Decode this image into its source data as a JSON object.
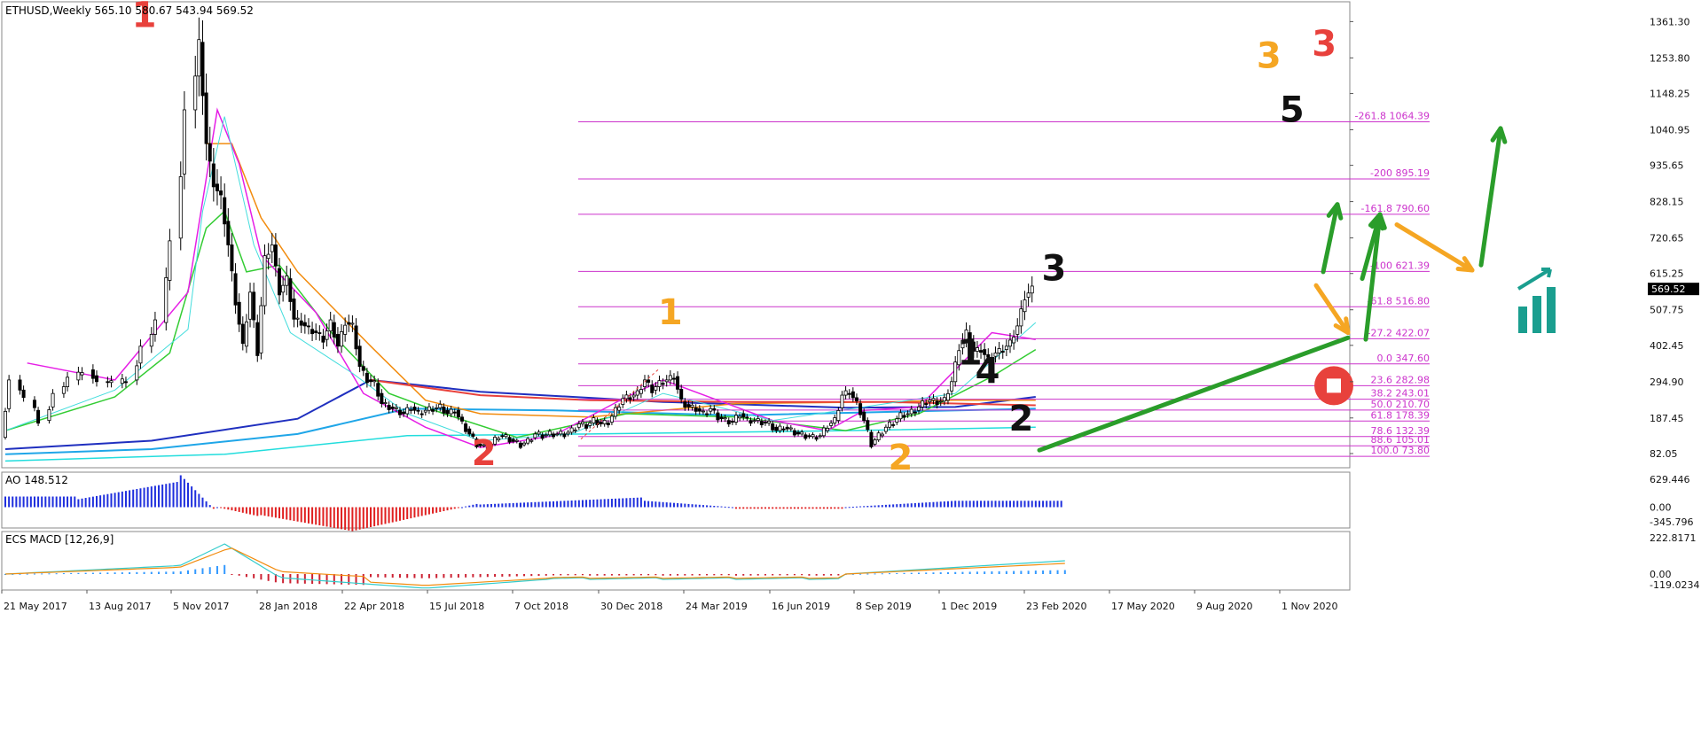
{
  "chart_data": {
    "type": "candlestick",
    "header": "ETHUSD,Weekly  565.10 580.67 543.94 569.52",
    "current_price_label": "569.52",
    "price_scale": {
      "min": 40,
      "max": 1420,
      "log": false
    },
    "price_ticks": [
      "1361.30",
      "1253.80",
      "1148.25",
      "1040.95",
      "935.65",
      "828.15",
      "720.65",
      "615.25",
      "507.75",
      "402.45",
      "294.90",
      "187.45",
      "82.05"
    ],
    "date_ticks": [
      "21 May 2017",
      "13 Aug 2017",
      "5 Nov 2017",
      "28 Jan 2018",
      "22 Apr 2018",
      "15 Jul 2018",
      "7 Oct 2018",
      "30 Dec 2018",
      "24 Mar 2019",
      "16 Jun 2019",
      "8 Sep 2019",
      "1 Dec 2019",
      "23 Feb 2020",
      "17 May 2020",
      "9 Aug 2020",
      "1 Nov 2020"
    ],
    "fib_levels": [
      {
        "label": "-261.8 1064.39",
        "value": 1064.39
      },
      {
        "label": "-200  895.19",
        "value": 895.19
      },
      {
        "label": "-161.8 790.60",
        "value": 790.6
      },
      {
        "label": "-100  621.39",
        "value": 621.39
      },
      {
        "label": "-61.8 516.80",
        "value": 516.8
      },
      {
        "label": "-27.2 422.07",
        "value": 422.07
      },
      {
        "label": "0.0 347.60",
        "value": 347.6
      },
      {
        "label": "23.6 282.98",
        "value": 282.98
      },
      {
        "label": "38.2 243.01",
        "value": 243.01
      },
      {
        "label": "50.0 210.70",
        "value": 210.7
      },
      {
        "label": "61.8 178.39",
        "value": 178.39
      },
      {
        "label": "78.6 132.39",
        "value": 132.39
      },
      {
        "label": "88.6 105.01",
        "value": 105.01
      },
      {
        "label": "100.0 73.80",
        "value": 73.8
      }
    ],
    "wave_labels": [
      {
        "text": "1",
        "color": "#e8413c",
        "date": 38,
        "price": 1345
      },
      {
        "text": "2",
        "color": "#e8413c",
        "date": 131,
        "price": 48
      },
      {
        "text": "1",
        "color": "#f5a623",
        "date": 182,
        "price": 465
      },
      {
        "text": "2",
        "color": "#f5a623",
        "date": 245,
        "price": 35
      },
      {
        "text": "1",
        "color": "#111111",
        "date": 264,
        "price": 345
      },
      {
        "text": "2",
        "color": "#111111",
        "date": 278,
        "price": 150
      },
      {
        "text": "3",
        "color": "#111111",
        "date": 287,
        "price": 595
      },
      {
        "text": "4",
        "color": "#111111",
        "date": 303,
        "price": 290
      },
      {
        "text": "5",
        "color": "#111111",
        "date": 369,
        "price": 1065
      },
      {
        "text": "3",
        "color": "#f5a623",
        "date": 364,
        "price": 1225
      },
      {
        "text": "3",
        "color": "#e8413c",
        "date": 376,
        "price": 1260
      }
    ],
    "weekly_closes": [
      {
        "i": 0,
        "c": 130
      },
      {
        "i": 4,
        "c": 300
      },
      {
        "i": 8,
        "c": 240
      },
      {
        "i": 12,
        "c": 180
      },
      {
        "i": 16,
        "c": 260
      },
      {
        "i": 20,
        "c": 300
      },
      {
        "i": 24,
        "c": 330
      },
      {
        "i": 28,
        "c": 295
      },
      {
        "i": 32,
        "c": 290
      },
      {
        "i": 36,
        "c": 300
      },
      {
        "i": 40,
        "c": 400
      },
      {
        "i": 44,
        "c": 470
      },
      {
        "i": 48,
        "c": 720
      },
      {
        "i": 52,
        "c": 1100
      },
      {
        "i": 54,
        "c": 1300
      },
      {
        "i": 56,
        "c": 1000
      },
      {
        "i": 58,
        "c": 880
      },
      {
        "i": 60,
        "c": 840
      },
      {
        "i": 62,
        "c": 700
      },
      {
        "i": 64,
        "c": 530
      },
      {
        "i": 66,
        "c": 400
      },
      {
        "i": 68,
        "c": 560
      },
      {
        "i": 70,
        "c": 380
      },
      {
        "i": 72,
        "c": 660
      },
      {
        "i": 74,
        "c": 700
      },
      {
        "i": 76,
        "c": 560
      },
      {
        "i": 78,
        "c": 600
      },
      {
        "i": 80,
        "c": 480
      },
      {
        "i": 82,
        "c": 470
      },
      {
        "i": 84,
        "c": 450
      },
      {
        "i": 86,
        "c": 440
      },
      {
        "i": 88,
        "c": 420
      },
      {
        "i": 90,
        "c": 470
      },
      {
        "i": 92,
        "c": 400
      },
      {
        "i": 94,
        "c": 470
      },
      {
        "i": 96,
        "c": 460
      },
      {
        "i": 98,
        "c": 340
      },
      {
        "i": 100,
        "c": 300
      },
      {
        "i": 102,
        "c": 290
      },
      {
        "i": 104,
        "c": 230
      },
      {
        "i": 106,
        "c": 220
      },
      {
        "i": 108,
        "c": 210
      },
      {
        "i": 110,
        "c": 200
      },
      {
        "i": 112,
        "c": 220
      },
      {
        "i": 114,
        "c": 200
      },
      {
        "i": 116,
        "c": 210
      },
      {
        "i": 118,
        "c": 215
      },
      {
        "i": 120,
        "c": 220
      },
      {
        "i": 122,
        "c": 200
      },
      {
        "i": 124,
        "c": 210
      },
      {
        "i": 126,
        "c": 170
      },
      {
        "i": 128,
        "c": 140
      },
      {
        "i": 130,
        "c": 110
      },
      {
        "i": 132,
        "c": 100
      },
      {
        "i": 134,
        "c": 110
      },
      {
        "i": 136,
        "c": 135
      },
      {
        "i": 138,
        "c": 130
      },
      {
        "i": 140,
        "c": 118
      },
      {
        "i": 142,
        "c": 108
      },
      {
        "i": 144,
        "c": 118
      },
      {
        "i": 146,
        "c": 140
      },
      {
        "i": 148,
        "c": 135
      },
      {
        "i": 150,
        "c": 140
      },
      {
        "i": 152,
        "c": 140
      },
      {
        "i": 154,
        "c": 140
      },
      {
        "i": 156,
        "c": 150
      },
      {
        "i": 158,
        "c": 170
      },
      {
        "i": 160,
        "c": 165
      },
      {
        "i": 162,
        "c": 180
      },
      {
        "i": 164,
        "c": 170
      },
      {
        "i": 166,
        "c": 175
      },
      {
        "i": 168,
        "c": 210
      },
      {
        "i": 170,
        "c": 245
      },
      {
        "i": 172,
        "c": 250
      },
      {
        "i": 174,
        "c": 260
      },
      {
        "i": 176,
        "c": 300
      },
      {
        "i": 178,
        "c": 270
      },
      {
        "i": 180,
        "c": 290
      },
      {
        "i": 182,
        "c": 300
      },
      {
        "i": 184,
        "c": 310
      },
      {
        "i": 186,
        "c": 235
      },
      {
        "i": 188,
        "c": 220
      },
      {
        "i": 190,
        "c": 215
      },
      {
        "i": 192,
        "c": 200
      },
      {
        "i": 194,
        "c": 215
      },
      {
        "i": 196,
        "c": 190
      },
      {
        "i": 198,
        "c": 180
      },
      {
        "i": 200,
        "c": 175
      },
      {
        "i": 202,
        "c": 200
      },
      {
        "i": 204,
        "c": 180
      },
      {
        "i": 206,
        "c": 180
      },
      {
        "i": 208,
        "c": 175
      },
      {
        "i": 210,
        "c": 170
      },
      {
        "i": 212,
        "c": 150
      },
      {
        "i": 214,
        "c": 160
      },
      {
        "i": 216,
        "c": 150
      },
      {
        "i": 218,
        "c": 140
      },
      {
        "i": 220,
        "c": 135
      },
      {
        "i": 222,
        "c": 130
      },
      {
        "i": 224,
        "c": 135
      },
      {
        "i": 226,
        "c": 165
      },
      {
        "i": 228,
        "c": 180
      },
      {
        "i": 230,
        "c": 255
      },
      {
        "i": 232,
        "c": 265
      },
      {
        "i": 234,
        "c": 230
      },
      {
        "i": 236,
        "c": 180
      },
      {
        "i": 238,
        "c": 110
      },
      {
        "i": 240,
        "c": 135
      },
      {
        "i": 242,
        "c": 160
      },
      {
        "i": 244,
        "c": 175
      },
      {
        "i": 246,
        "c": 195
      },
      {
        "i": 248,
        "c": 200
      },
      {
        "i": 250,
        "c": 210
      },
      {
        "i": 252,
        "c": 230
      },
      {
        "i": 254,
        "c": 240
      },
      {
        "i": 256,
        "c": 235
      },
      {
        "i": 258,
        "c": 240
      },
      {
        "i": 260,
        "c": 295
      },
      {
        "i": 262,
        "c": 395
      },
      {
        "i": 264,
        "c": 440
      },
      {
        "i": 266,
        "c": 385
      },
      {
        "i": 268,
        "c": 390
      },
      {
        "i": 270,
        "c": 360
      },
      {
        "i": 272,
        "c": 380
      },
      {
        "i": 274,
        "c": 390
      },
      {
        "i": 276,
        "c": 410
      },
      {
        "i": 278,
        "c": 460
      },
      {
        "i": 280,
        "c": 545
      },
      {
        "i": 282,
        "c": 570
      }
    ],
    "indicators": {
      "ao_label": "AO 148.512",
      "ao_scale": [
        "629.446",
        "0.00",
        "-345.796"
      ],
      "macd_label": "ECS MACD [12,26,9]",
      "macd_scale": [
        "222.8171",
        "0.00",
        "-119.0234"
      ]
    },
    "colors": {
      "fib": "#cc33cc",
      "bull_arrow": "#2a9d2a",
      "bear_arrow": "#f5a623",
      "stop": "#e8413c",
      "ma_blue": "#1f2fbf",
      "ma_sky": "#1fa6e8",
      "ma_orange": "#f28c0f",
      "ma_red": "#e8413c",
      "ma_green": "#33cc33",
      "ma_magenta": "#e61ee6",
      "ma_cyan": "#44dddd",
      "ao_up": "#1f2fdd",
      "ao_down": "#e02020",
      "macd_up": "#3399ff",
      "macd_down": "#cc2233"
    }
  }
}
